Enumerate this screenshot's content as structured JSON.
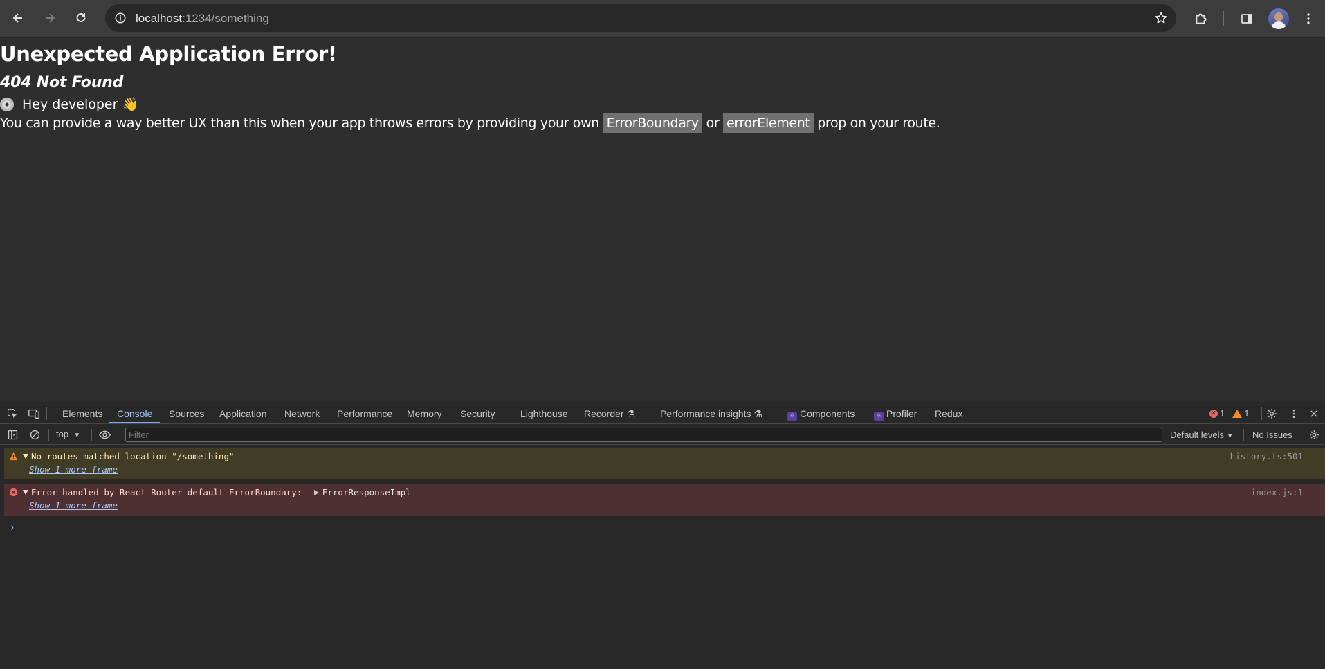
{
  "browser": {
    "url_host": "localhost",
    "url_path": ":1234/something"
  },
  "page": {
    "title": "Unexpected Application Error!",
    "status": "404 Not Found",
    "greeting": "Hey developer",
    "greeting_emoji": "👋",
    "message_before": "You can provide a way better UX than this when your app throws errors by providing your own ",
    "code1": "ErrorBoundary",
    "message_middle": " or ",
    "code2": "errorElement",
    "message_after": " prop on your route."
  },
  "devtools": {
    "tabs": [
      "Elements",
      "Console",
      "Sources",
      "Application",
      "Network",
      "Performance",
      "Memory",
      "Security",
      "Lighthouse",
      "Recorder",
      "Performance insights",
      "Components",
      "Profiler",
      "Redux"
    ],
    "active_tab": "Console",
    "error_count": "1",
    "warning_count": "1",
    "context": "top",
    "filter_placeholder": "Filter",
    "levels": "Default levels",
    "issues": "No Issues",
    "messages": [
      {
        "level": "warning",
        "text": "No routes matched location \"/something\"",
        "more": "Show 1 more frame",
        "source": "history.ts:501"
      },
      {
        "level": "error",
        "text": "Error handled by React Router default ErrorBoundary: ",
        "object": "ErrorResponseImpl",
        "more": "Show 1 more frame",
        "source": "index.js:1"
      }
    ],
    "prompt": "›"
  }
}
